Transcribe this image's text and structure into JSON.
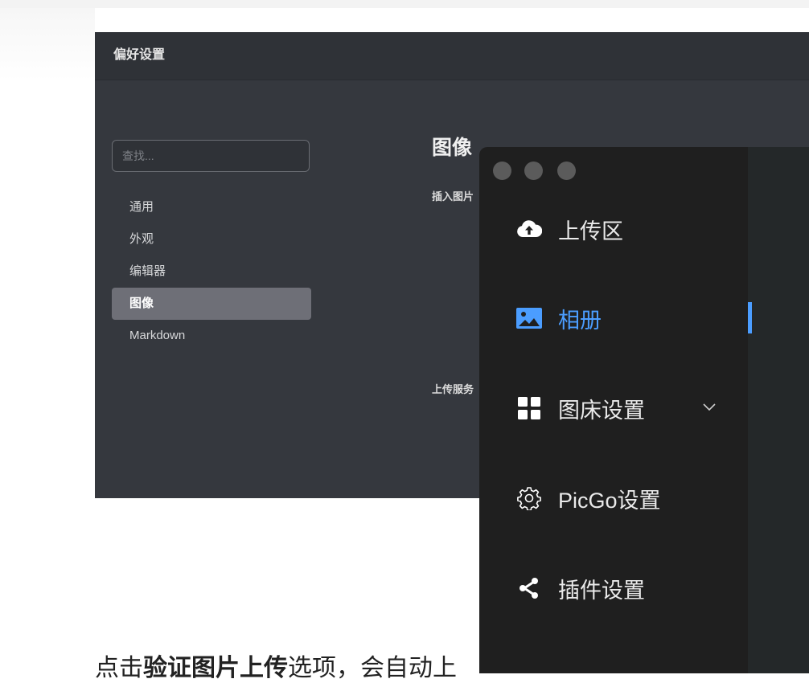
{
  "preferences": {
    "title": "偏好设置",
    "search_placeholder": "查找...",
    "nav": [
      {
        "label": "通用"
      },
      {
        "label": "外观"
      },
      {
        "label": "编辑器"
      },
      {
        "label": "图像",
        "active": true
      },
      {
        "label": "Markdown"
      }
    ],
    "section_heading": "图像",
    "insert_image_label": "插入图片",
    "upload_service_label": "上传服务"
  },
  "picgo": {
    "nav": [
      {
        "label": "上传区",
        "icon": "cloud-upload-icon"
      },
      {
        "label": "相册",
        "icon": "image-icon",
        "active": true
      },
      {
        "label": "图床设置",
        "icon": "grid-icon",
        "has_submenu": true
      },
      {
        "label": "PicGo设置",
        "icon": "gear-icon"
      },
      {
        "label": "插件设置",
        "icon": "share-icon"
      }
    ],
    "accent_color": "#4b9dff"
  },
  "article": {
    "prefix": "点击",
    "bold": "验证图片上传",
    "suffix": "选项，会自动上"
  }
}
